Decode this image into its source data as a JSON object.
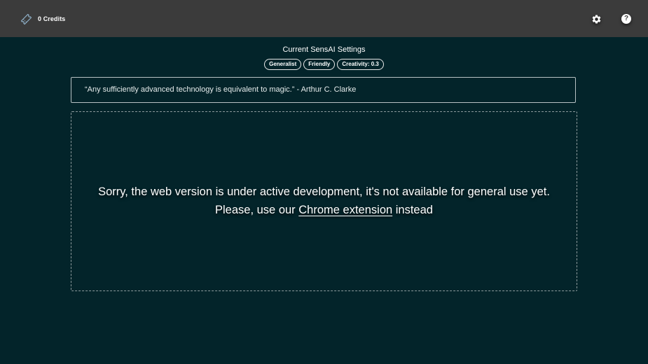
{
  "header": {
    "credits_label": "0 Credits",
    "credits_icon": "ticket-icon",
    "settings_icon": "gear-icon",
    "help_icon": "help-icon",
    "help_glyph": "?"
  },
  "settings": {
    "title": "Current SensAI Settings",
    "chips": [
      "Generalist",
      "Friendly",
      "Creativity: 0.3"
    ]
  },
  "quote": {
    "text": "“Any sufficiently advanced technology is equivalent to magic.” - Arthur C. Clarke"
  },
  "notice": {
    "line1": "Sorry, the web version is under active development, it's not available for general use yet.",
    "line2_prefix": "Please, use our ",
    "link_text": "Chrome extension",
    "line2_suffix": " instead"
  },
  "colors": {
    "background": "#03242a",
    "topbar": "#3b3b3b",
    "ticket_outline": "#6f8fa8"
  }
}
